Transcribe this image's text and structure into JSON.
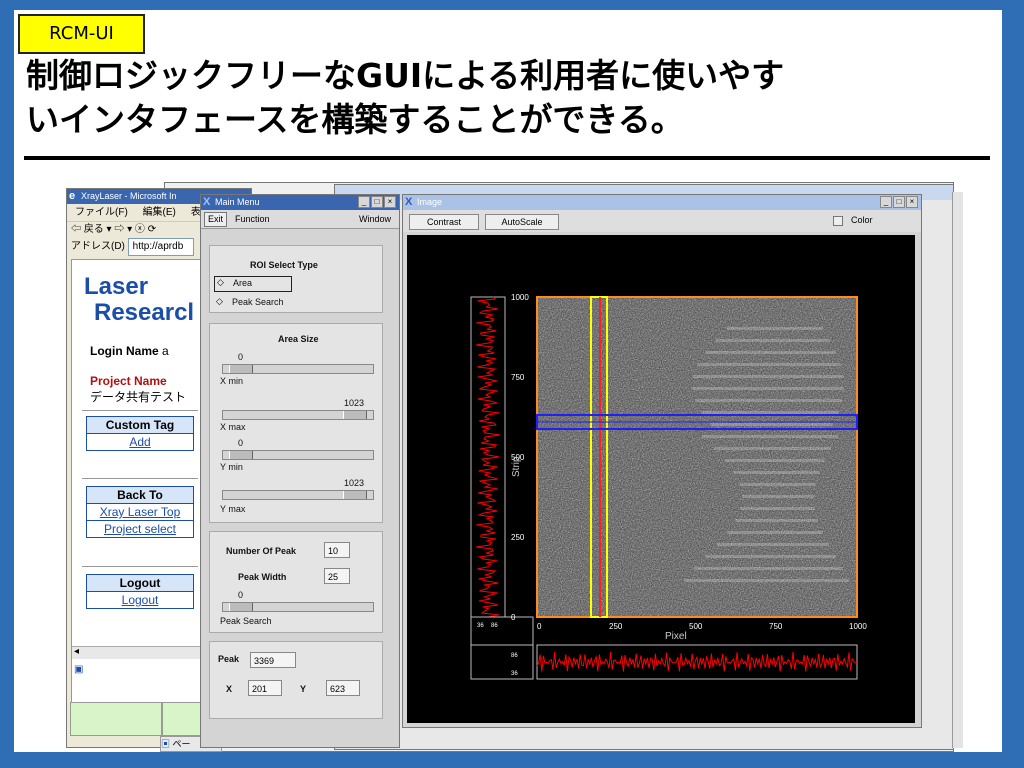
{
  "slide": {
    "tag": "RCM-UI",
    "headline_line1": "制御ロジックフリーなGUIによる利用者に使いやす",
    "headline_line2": "いインタフェースを構築することができる。"
  },
  "browser": {
    "title": "XrayLaser - Microsoft In",
    "menu": [
      "ファイル(F)",
      "編集(E)",
      "表示"
    ],
    "nav": "⇦ 戻る ▾ ⇨ ▾ ⓧ ⟳",
    "address_label": "アドレス(D)",
    "address_value": "http://aprdb",
    "logo_line1": "Laser",
    "logo_line2": "Researcl",
    "login_label": "Login Name",
    "login_value": "a",
    "project_label": "Project Name",
    "project_value": "データ共有テスト",
    "custom_tag": "Custom Tag",
    "add": "Add",
    "back_to": "Back To",
    "xray_top": "Xray Laser Top",
    "project_select": "Project select",
    "logout_header": "Logout",
    "logout_link": "Logout",
    "status": "ペー"
  },
  "mainmenu": {
    "title": "Main Menu",
    "exit": "Exit",
    "function": "Function",
    "window": "Window",
    "roi_title": "ROI Select Type",
    "roi_area": "Area",
    "roi_peak": "Peak Search",
    "area_size": "Area Size",
    "xmin_val": "0",
    "xmin_label": "X min",
    "xmax_val": "1023",
    "xmax_label": "X max",
    "ymin_val": "0",
    "ymin_label": "Y min",
    "ymax_val": "1023",
    "ymax_label": "Y max",
    "num_peak_label": "Number Of Peak",
    "num_peak_value": "10",
    "peak_width_label": "Peak Width",
    "peak_width_value": "25",
    "peak_search_val": "0",
    "peak_search_label": "Peak Search",
    "peak_label": "Peak",
    "peak_value": "3369",
    "x_label": "X",
    "x_value": "201",
    "y_label": "Y",
    "y_value": "623"
  },
  "image_window": {
    "title": "Image",
    "contrast": "Contrast",
    "autoscale": "AutoScale",
    "color": "Color",
    "y_axis_label": "Strip",
    "x_axis_label": "Pixel",
    "y_ticks": [
      "1000",
      "750",
      "500",
      "250",
      "0"
    ],
    "x_ticks": [
      "0",
      "250",
      "500",
      "750",
      "1000"
    ],
    "side_ticks": [
      "36",
      "86"
    ],
    "bottom_ticks": [
      "86",
      "36"
    ]
  },
  "colors": {
    "accent": "#2f6db5",
    "tag_bg": "#ffff00",
    "profile": "#ff0000",
    "roi_yellow": "#ffff00",
    "roi_blue": "#2020ff",
    "frame": "#ff8c1a"
  }
}
